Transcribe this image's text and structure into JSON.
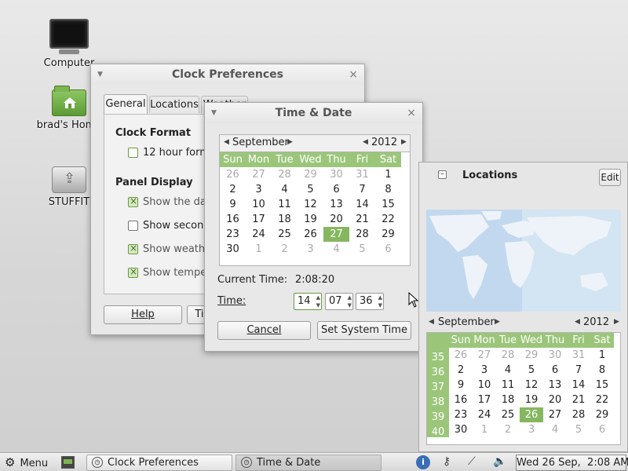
{
  "desktop": {
    "icons": [
      {
        "label": "Computer"
      },
      {
        "label": "brad's Home"
      },
      {
        "label": "STUFFIT"
      }
    ]
  },
  "clock_prefs": {
    "title": "Clock Preferences",
    "tabs": [
      "General",
      "Locations",
      "Weather"
    ],
    "clock_format_heading": "Clock Format",
    "hour_format_label": "12 hour format",
    "panel_display_heading": "Panel Display",
    "options": [
      {
        "label": "Show the date",
        "checked": true
      },
      {
        "label": "Show seconds",
        "checked": false
      },
      {
        "label": "Show weather",
        "checked": true
      },
      {
        "label": "Show temperature",
        "checked": true
      }
    ],
    "help_button": "Help",
    "time_settings_button": "Time Settings"
  },
  "time_date": {
    "title": "Time & Date",
    "month": "September",
    "year": "2012",
    "weekdays": [
      "Sun",
      "Mon",
      "Tue",
      "Wed",
      "Thu",
      "Fri",
      "Sat"
    ],
    "weeks": [
      [
        "26",
        "27",
        "28",
        "29",
        "30",
        "31",
        "1"
      ],
      [
        "2",
        "3",
        "4",
        "5",
        "6",
        "7",
        "8"
      ],
      [
        "9",
        "10",
        "11",
        "12",
        "13",
        "14",
        "15"
      ],
      [
        "16",
        "17",
        "18",
        "19",
        "20",
        "21",
        "22"
      ],
      [
        "23",
        "24",
        "25",
        "26",
        "27",
        "28",
        "29"
      ],
      [
        "30",
        "1",
        "2",
        "3",
        "4",
        "5",
        "6"
      ]
    ],
    "selected_day": "27",
    "current_time_label": "Current Time:",
    "current_time_value": "2:08:20",
    "time_label": "Time:",
    "hour": "14",
    "minute": "07",
    "second": "36",
    "cancel_button": "Cancel",
    "set_button": "Set System Time"
  },
  "clock_popup": {
    "locations_label": "Locations",
    "edit_button": "Edit",
    "month": "September",
    "year": "2012",
    "weekdays": [
      "Sun",
      "Mon",
      "Tue",
      "Wed",
      "Thu",
      "Fri",
      "Sat"
    ],
    "week_numbers": [
      "35",
      "36",
      "37",
      "38",
      "39",
      "40"
    ],
    "weeks": [
      [
        "26",
        "27",
        "28",
        "29",
        "30",
        "31",
        "1"
      ],
      [
        "2",
        "3",
        "4",
        "5",
        "6",
        "7",
        "8"
      ],
      [
        "9",
        "10",
        "11",
        "12",
        "13",
        "14",
        "15"
      ],
      [
        "16",
        "17",
        "18",
        "19",
        "20",
        "21",
        "22"
      ],
      [
        "23",
        "24",
        "25",
        "26",
        "27",
        "28",
        "29"
      ],
      [
        "30",
        "1",
        "2",
        "3",
        "4",
        "5",
        "6"
      ]
    ],
    "today": "26"
  },
  "taskbar": {
    "menu_label": "Menu",
    "windows": [
      {
        "label": "Clock Preferences"
      },
      {
        "label": "Time & Date"
      }
    ],
    "clock": "Wed 26 Sep,  2:08 AM"
  },
  "colors": {
    "accent": "#9bc67a",
    "selected": "#86b760"
  }
}
